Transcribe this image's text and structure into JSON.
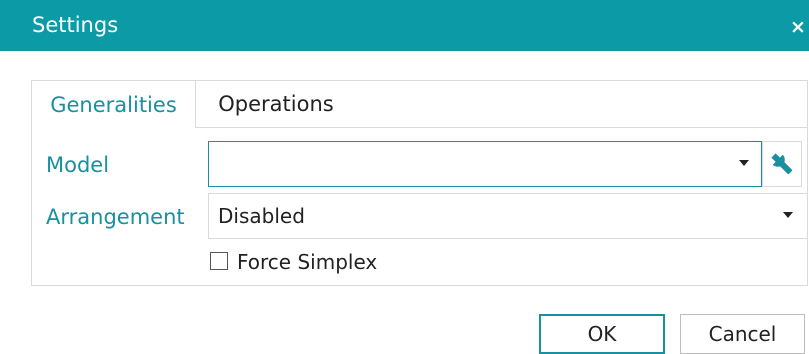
{
  "window": {
    "title": "Settings",
    "close_glyph": "×"
  },
  "tabs": [
    {
      "label": "Generalities",
      "active": true
    },
    {
      "label": "Operations",
      "active": false
    }
  ],
  "form": {
    "model_label": "Model",
    "model_value": "",
    "arrangement_label": "Arrangement",
    "arrangement_value": "Disabled",
    "force_simplex_label": "Force Simplex",
    "force_simplex_checked": false
  },
  "buttons": {
    "ok_label": "OK",
    "cancel_label": "Cancel"
  },
  "icons": {
    "wrench": "wrench-icon",
    "dropdown": "chevron-down-icon",
    "close": "close-icon"
  },
  "colors": {
    "titlebar": "#0c9aa6",
    "accent": "#1a8fa0",
    "border": "#dadada"
  }
}
